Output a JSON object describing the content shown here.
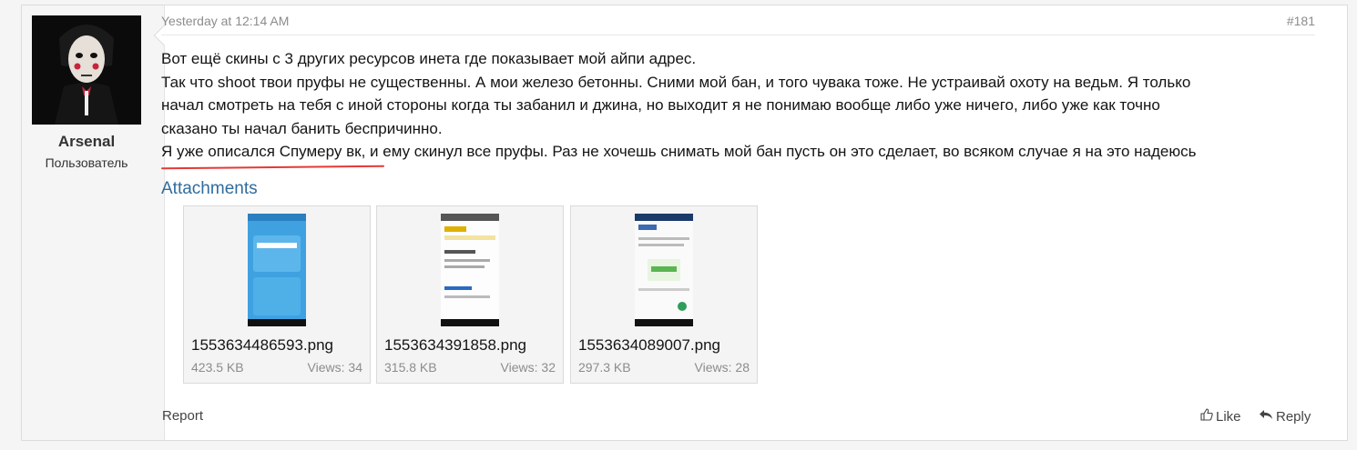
{
  "user": {
    "name": "Arsenal",
    "title": "Пользователь"
  },
  "post": {
    "date": "Yesterday at 12:14 AM",
    "number": "#181",
    "lines": [
      "Вот ещё скины с 3 других ресурсов инета где показывает мой айпи адрес.",
      "Так что shoot твои пруфы не существенны. А мои железо бетонны. Сними мой бан, и того чувака тоже. Не устраивай охоту на ведьм. Я только",
      "начал смотреть на тебя с иной стороны когда ты забанил и джина, но выходит я не понимаю вообще либо уже ничего, либо уже как точно",
      "сказано ты начал банить беспричинно.",
      "Я уже описался Спумеру вк, и ему скинул все пруфы. Раз не хочешь снимать мой бан пусть он это сделает, во всяком случае я на это надеюсь"
    ]
  },
  "attachments": {
    "title": "Attachments",
    "items": [
      {
        "name": "1553634486593.png",
        "size": "423.5 KB",
        "views": "Views: 34"
      },
      {
        "name": "1553634391858.png",
        "size": "315.8 KB",
        "views": "Views: 32"
      },
      {
        "name": "1553634089007.png",
        "size": "297.3 KB",
        "views": "Views: 28"
      }
    ]
  },
  "actions": {
    "report": "Report",
    "like": "Like",
    "reply": "Reply"
  },
  "colors": {
    "link": "#2f6c9e",
    "underline": "#e53935"
  }
}
